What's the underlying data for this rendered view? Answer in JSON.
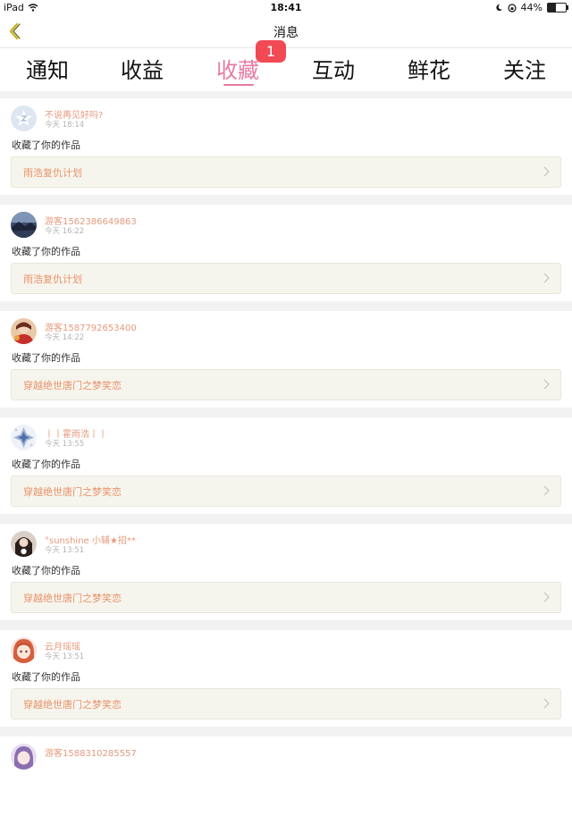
{
  "status_bar": {
    "device": "iPad",
    "time": "18:41",
    "battery": "44%",
    "battery_level": 0.44
  },
  "nav": {
    "title": "消息",
    "back_icon": "chevron-left-icon",
    "accent": "#c9b41e"
  },
  "tabs": [
    {
      "label": "通知",
      "active": false
    },
    {
      "label": "收益",
      "active": false
    },
    {
      "label": "收藏",
      "active": true
    },
    {
      "label": "互动",
      "active": false
    },
    {
      "label": "鲜花",
      "active": false
    },
    {
      "label": "关注",
      "active": false
    }
  ],
  "badge": "1",
  "colors": {
    "active_tab": "#e77aa3",
    "badge": "#f14a55",
    "username": "#e49a7d",
    "work_title": "#e8926b"
  },
  "items": [
    {
      "username": "不说再见好吗?",
      "time": "今天 18:14",
      "action": "收藏了你的作品",
      "work": "雨浩复仇计划",
      "avatar": "default-star"
    },
    {
      "username": "游客1562386649863",
      "time": "今天 16:22",
      "action": "收藏了你的作品",
      "work": "雨浩复仇计划",
      "avatar": "landscape"
    },
    {
      "username": "游客1587792653400",
      "time": "今天 14:22",
      "action": "收藏了你的作品",
      "work": "穿越绝世唐门之梦笑恋",
      "avatar": "red-figure"
    },
    {
      "username": "丨丨霍雨浩丨丨",
      "time": "今天 13:55",
      "action": "收藏了你的作品",
      "work": "穿越绝世唐门之梦笑恋",
      "avatar": "blue-crystal"
    },
    {
      "username": "°sunshine 小辅★招**",
      "time": "今天 13:51",
      "action": "收藏了你的作品",
      "work": "穿越绝世唐门之梦笑恋",
      "avatar": "dark-figure"
    },
    {
      "username": "云月瑶瑶",
      "time": "今天 13:51",
      "action": "收藏了你的作品",
      "work": "穿越绝世唐门之梦笑恋",
      "avatar": "anime-girl"
    },
    {
      "username": "游客1588310285557",
      "time": "",
      "action": "",
      "work": "",
      "avatar": "purple-figure"
    }
  ]
}
